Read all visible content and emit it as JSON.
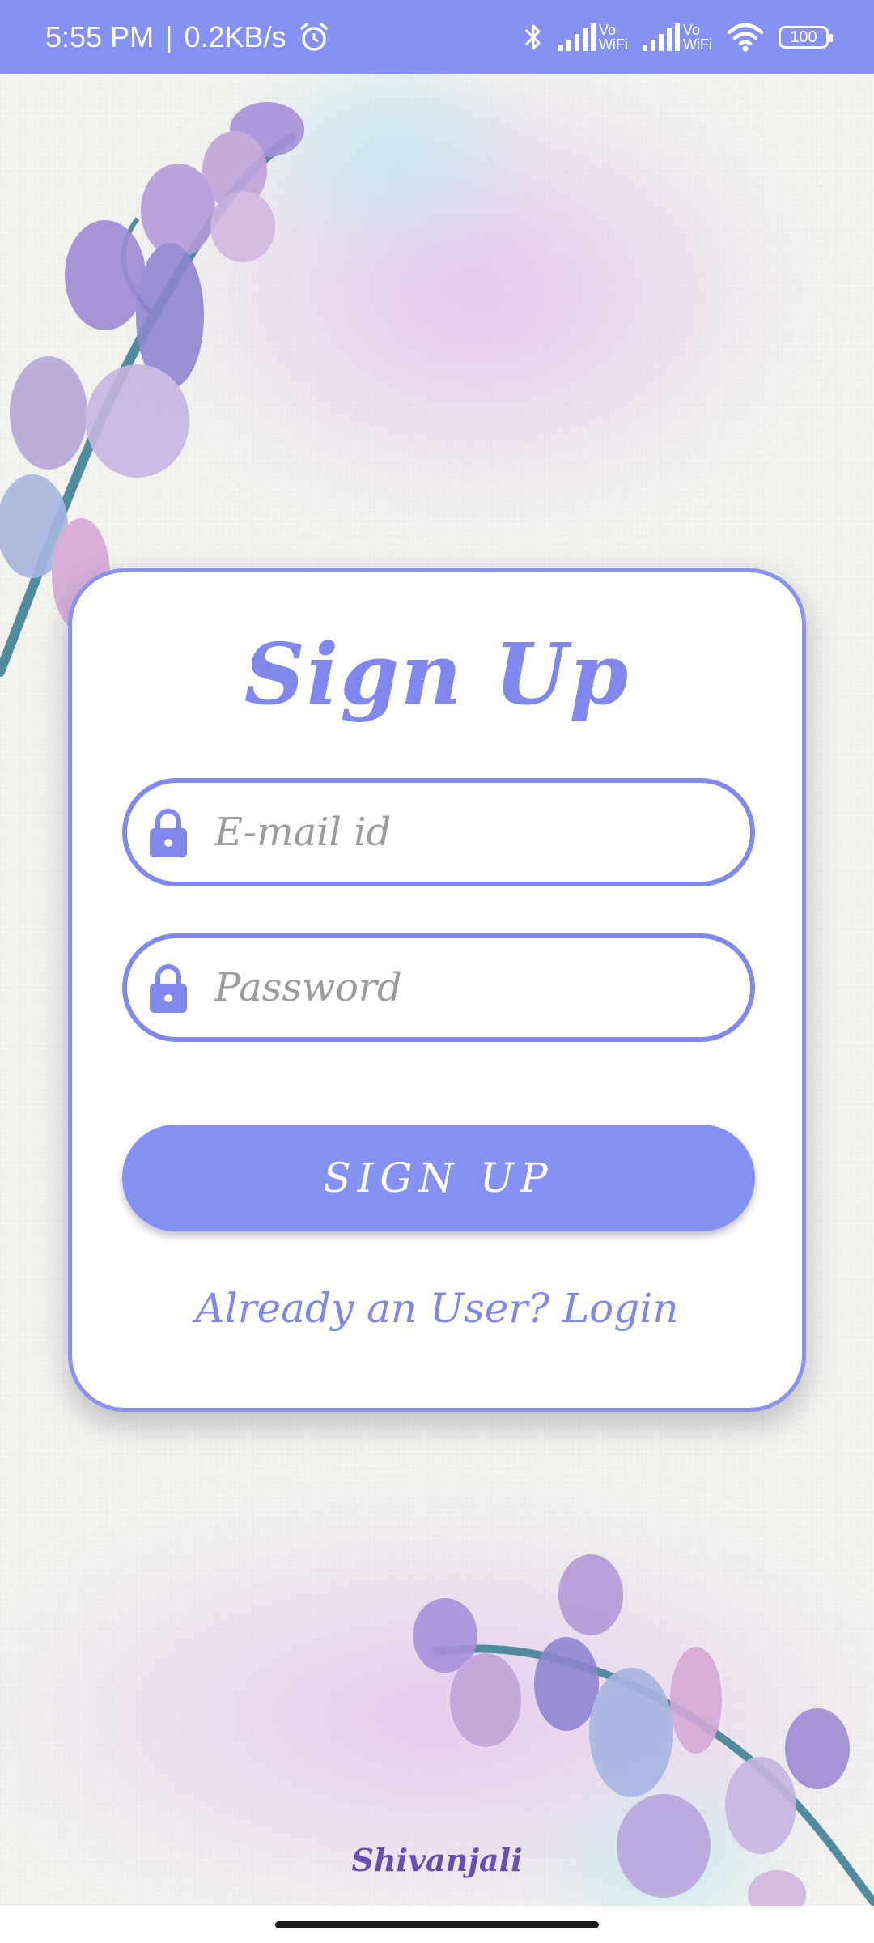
{
  "status_bar": {
    "time": "5:55 PM",
    "separator": "|",
    "speed": "0.2KB/s",
    "vowifi_1_top": "Vo",
    "vowifi_1_bottom": "WiFi",
    "vowifi_2_top": "Vo",
    "vowifi_2_bottom": "WiFi",
    "battery": "100",
    "icons": [
      "alarm-icon",
      "bluetooth-icon",
      "signal-icon",
      "signal-icon",
      "wifi-icon",
      "battery-icon"
    ]
  },
  "signup_card": {
    "title": "Sign Up",
    "email_placeholder": "E-mail id",
    "password_placeholder": "Password",
    "submit_label": "SIGN UP",
    "login_link": "Already an User? Login"
  },
  "footer": {
    "signature": "Shivanjali"
  },
  "colors": {
    "accent": "#8590f3",
    "text_accent": "#8088ee",
    "placeholder": "#9c9c9c",
    "card_bg": "#ffffff"
  }
}
